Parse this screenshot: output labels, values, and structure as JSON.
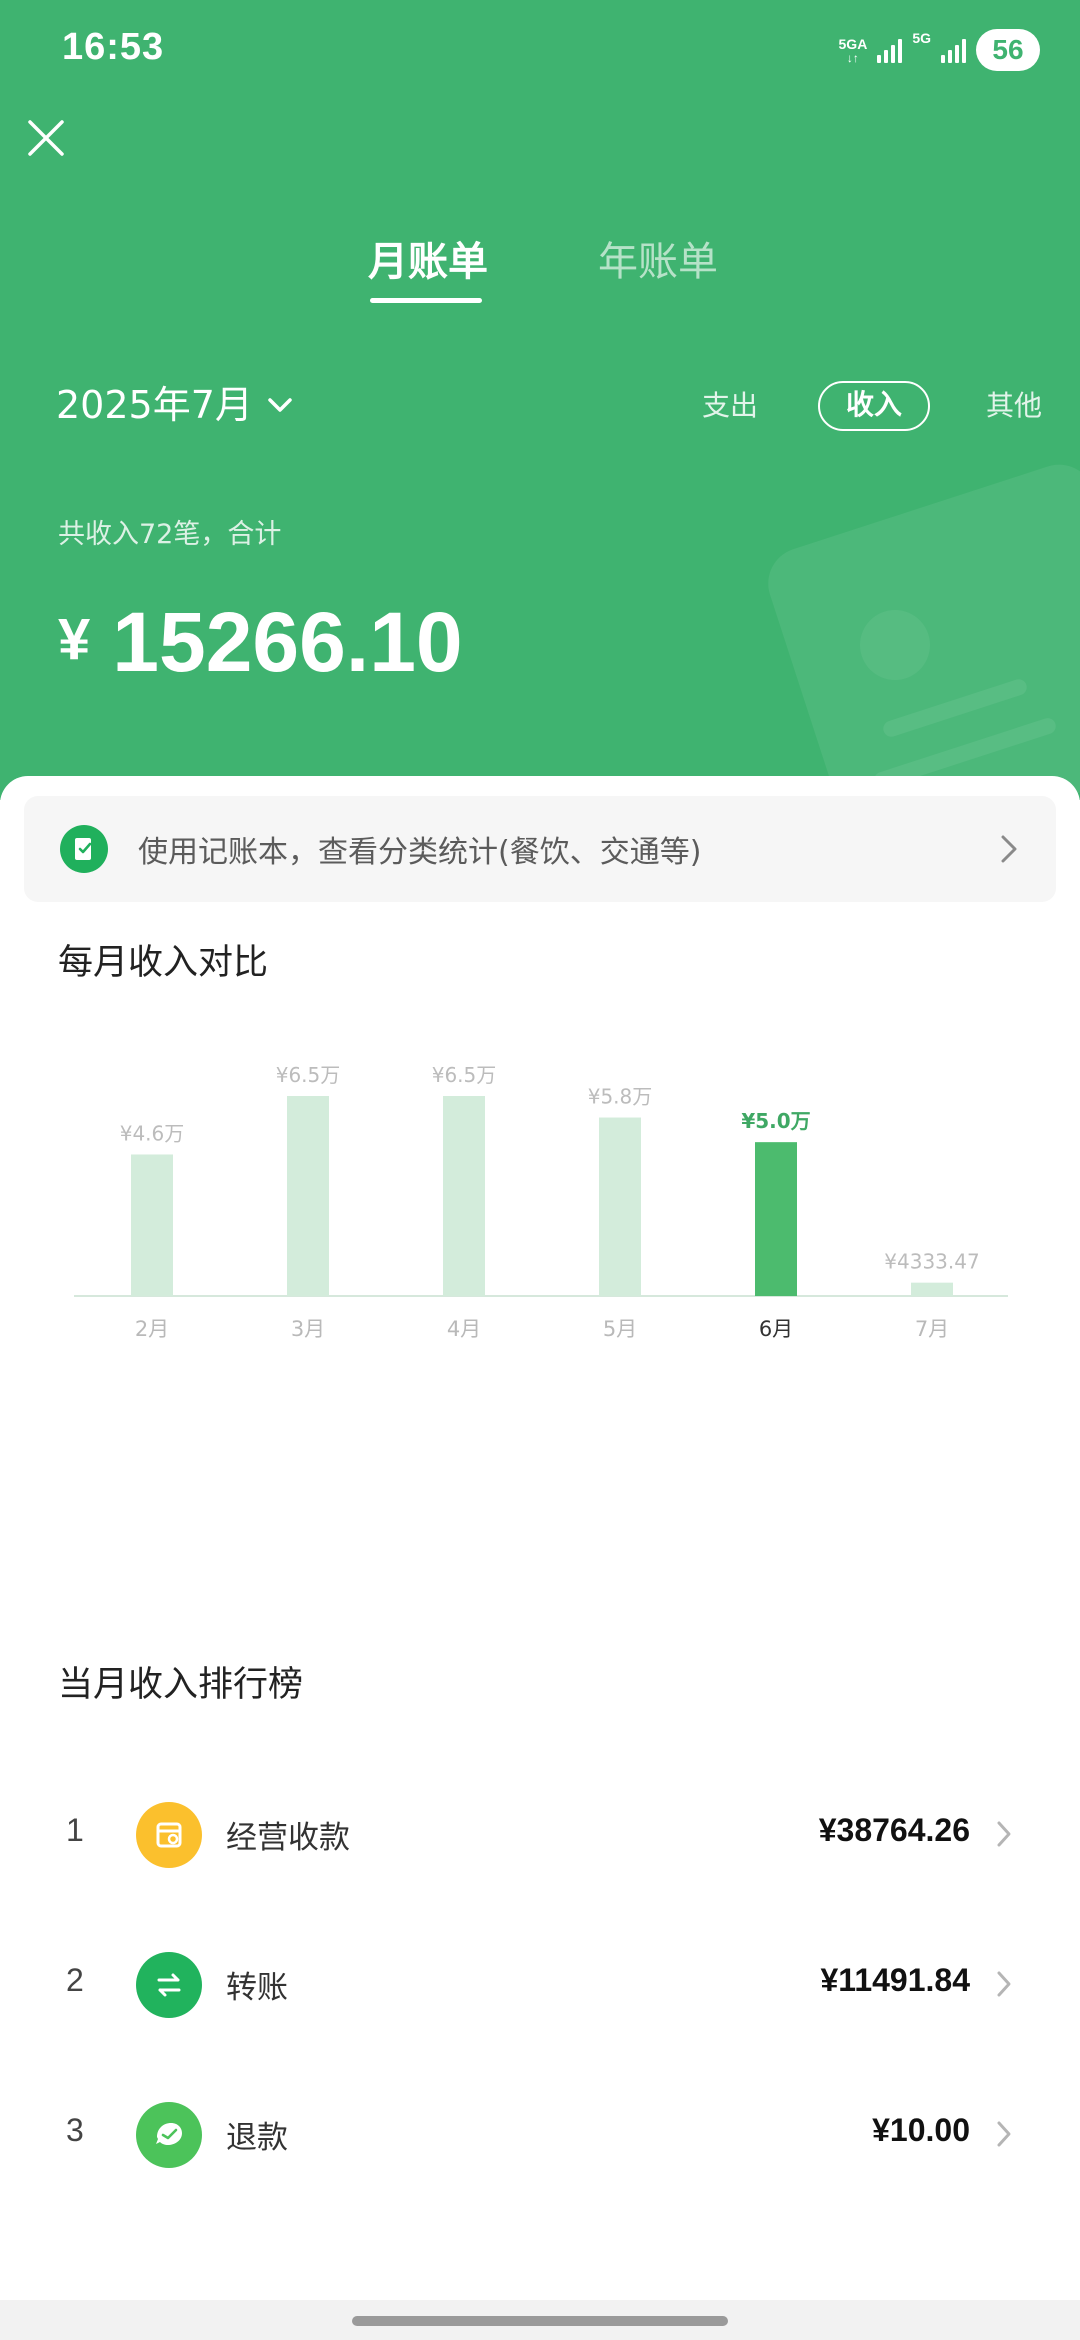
{
  "status_bar": {
    "time": "16:53",
    "network_1": "5GA",
    "network_2": "5G",
    "battery": "56"
  },
  "header": {
    "close_icon": "close-icon",
    "tabs": [
      {
        "label": "月账单",
        "active": true
      },
      {
        "label": "年账单",
        "active": false
      }
    ],
    "month": "2025年7月",
    "type_filter": [
      {
        "label": "支出",
        "active": false
      },
      {
        "label": "收入",
        "active": true
      },
      {
        "label": "其他",
        "active": false
      }
    ],
    "summary": "共收入72笔，合计",
    "currency": "¥",
    "total": "15266.10",
    "accent_color": "#3fb370"
  },
  "banner": {
    "text": "使用记账本，查看分类统计(餐饮、交通等)"
  },
  "chart_section": {
    "title": "每月收入对比"
  },
  "chart_data": {
    "type": "bar",
    "categories": [
      "2月",
      "3月",
      "4月",
      "5月",
      "6月",
      "7月"
    ],
    "values": [
      46000,
      65000,
      65000,
      58000,
      50000,
      4333.47
    ],
    "data_labels": [
      "¥4.6万",
      "¥6.5万",
      "¥6.5万",
      "¥5.8万",
      "¥5.0万",
      "¥4333.47"
    ],
    "highlight_index": 4,
    "ylim": [
      0,
      65000
    ],
    "grid": false,
    "colors": {
      "bar": "#d3ecdb",
      "highlight": "#4cbb6e",
      "label": "#bcbcbc",
      "highlight_label": "#3fa864"
    }
  },
  "ranking": {
    "title": "当月收入排行榜",
    "items": [
      {
        "rank": "1",
        "label": "经营收款",
        "amount": "¥38764.26",
        "icon": "shop-icon",
        "color": "#fbc02d"
      },
      {
        "rank": "2",
        "label": "转账",
        "amount": "¥11491.84",
        "icon": "transfer-icon",
        "color": "#21b35d"
      },
      {
        "rank": "3",
        "label": "退款",
        "amount": "¥10.00",
        "icon": "refund-icon",
        "color": "#4cc35a"
      }
    ]
  }
}
